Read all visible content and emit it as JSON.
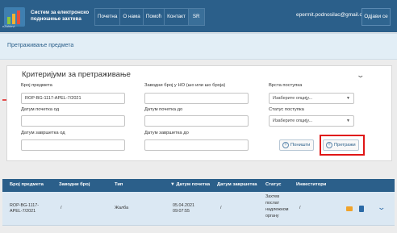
{
  "header": {
    "app_title": "Систем за електронско подношење захтева",
    "logo_caption": "eZahtevi",
    "nav": [
      "Почетна",
      "О нама",
      "Помоћ",
      "Контакт",
      "SR"
    ],
    "email": "epermit.podnosilac@gmail.com",
    "logout": "Одјави се"
  },
  "page_title": "Претраживање предмета",
  "criteria": {
    "title": "Критеријуми за претраживање",
    "case_number_label": "Број предмета",
    "case_number_value": "ROP-BG-1117-APEL-7/2021",
    "registry_label": "Заводни број у НО (шо или шо броја)",
    "procedure_type_label": "Врста поступка",
    "procedure_type_value": "Изаберите опцију...",
    "start_from_label": "Датум почетка од",
    "start_to_label": "Датум почетка до",
    "procedure_status_label": "Статус поступка",
    "procedure_status_value": "Изаберите опцију...",
    "end_from_label": "Датум завршетка од",
    "end_to_label": "Датум завршетка до",
    "clear_button": "Поништи",
    "search_button": "Претражи"
  },
  "table": {
    "columns": [
      "Број предмета",
      "Заводни број",
      "Тип",
      "▼ Датум почетка",
      "Датум завршетка",
      "Статус",
      "Инвеститори"
    ],
    "rows": [
      {
        "case_number_1": "ROP-BG-1117-",
        "case_number_2": "APEL-7/2021",
        "registry": "/",
        "type": "Жалба",
        "start_date_1": "05.04.2021",
        "start_date_2": "09:07:55",
        "end_date": "/",
        "status_1": "Захтев",
        "status_2": "послат",
        "status_3": "надлежном",
        "status_4": "органу",
        "investors": "/"
      }
    ]
  },
  "colors": {
    "brand": "#2b5f8a",
    "highlight": "#e01616"
  }
}
